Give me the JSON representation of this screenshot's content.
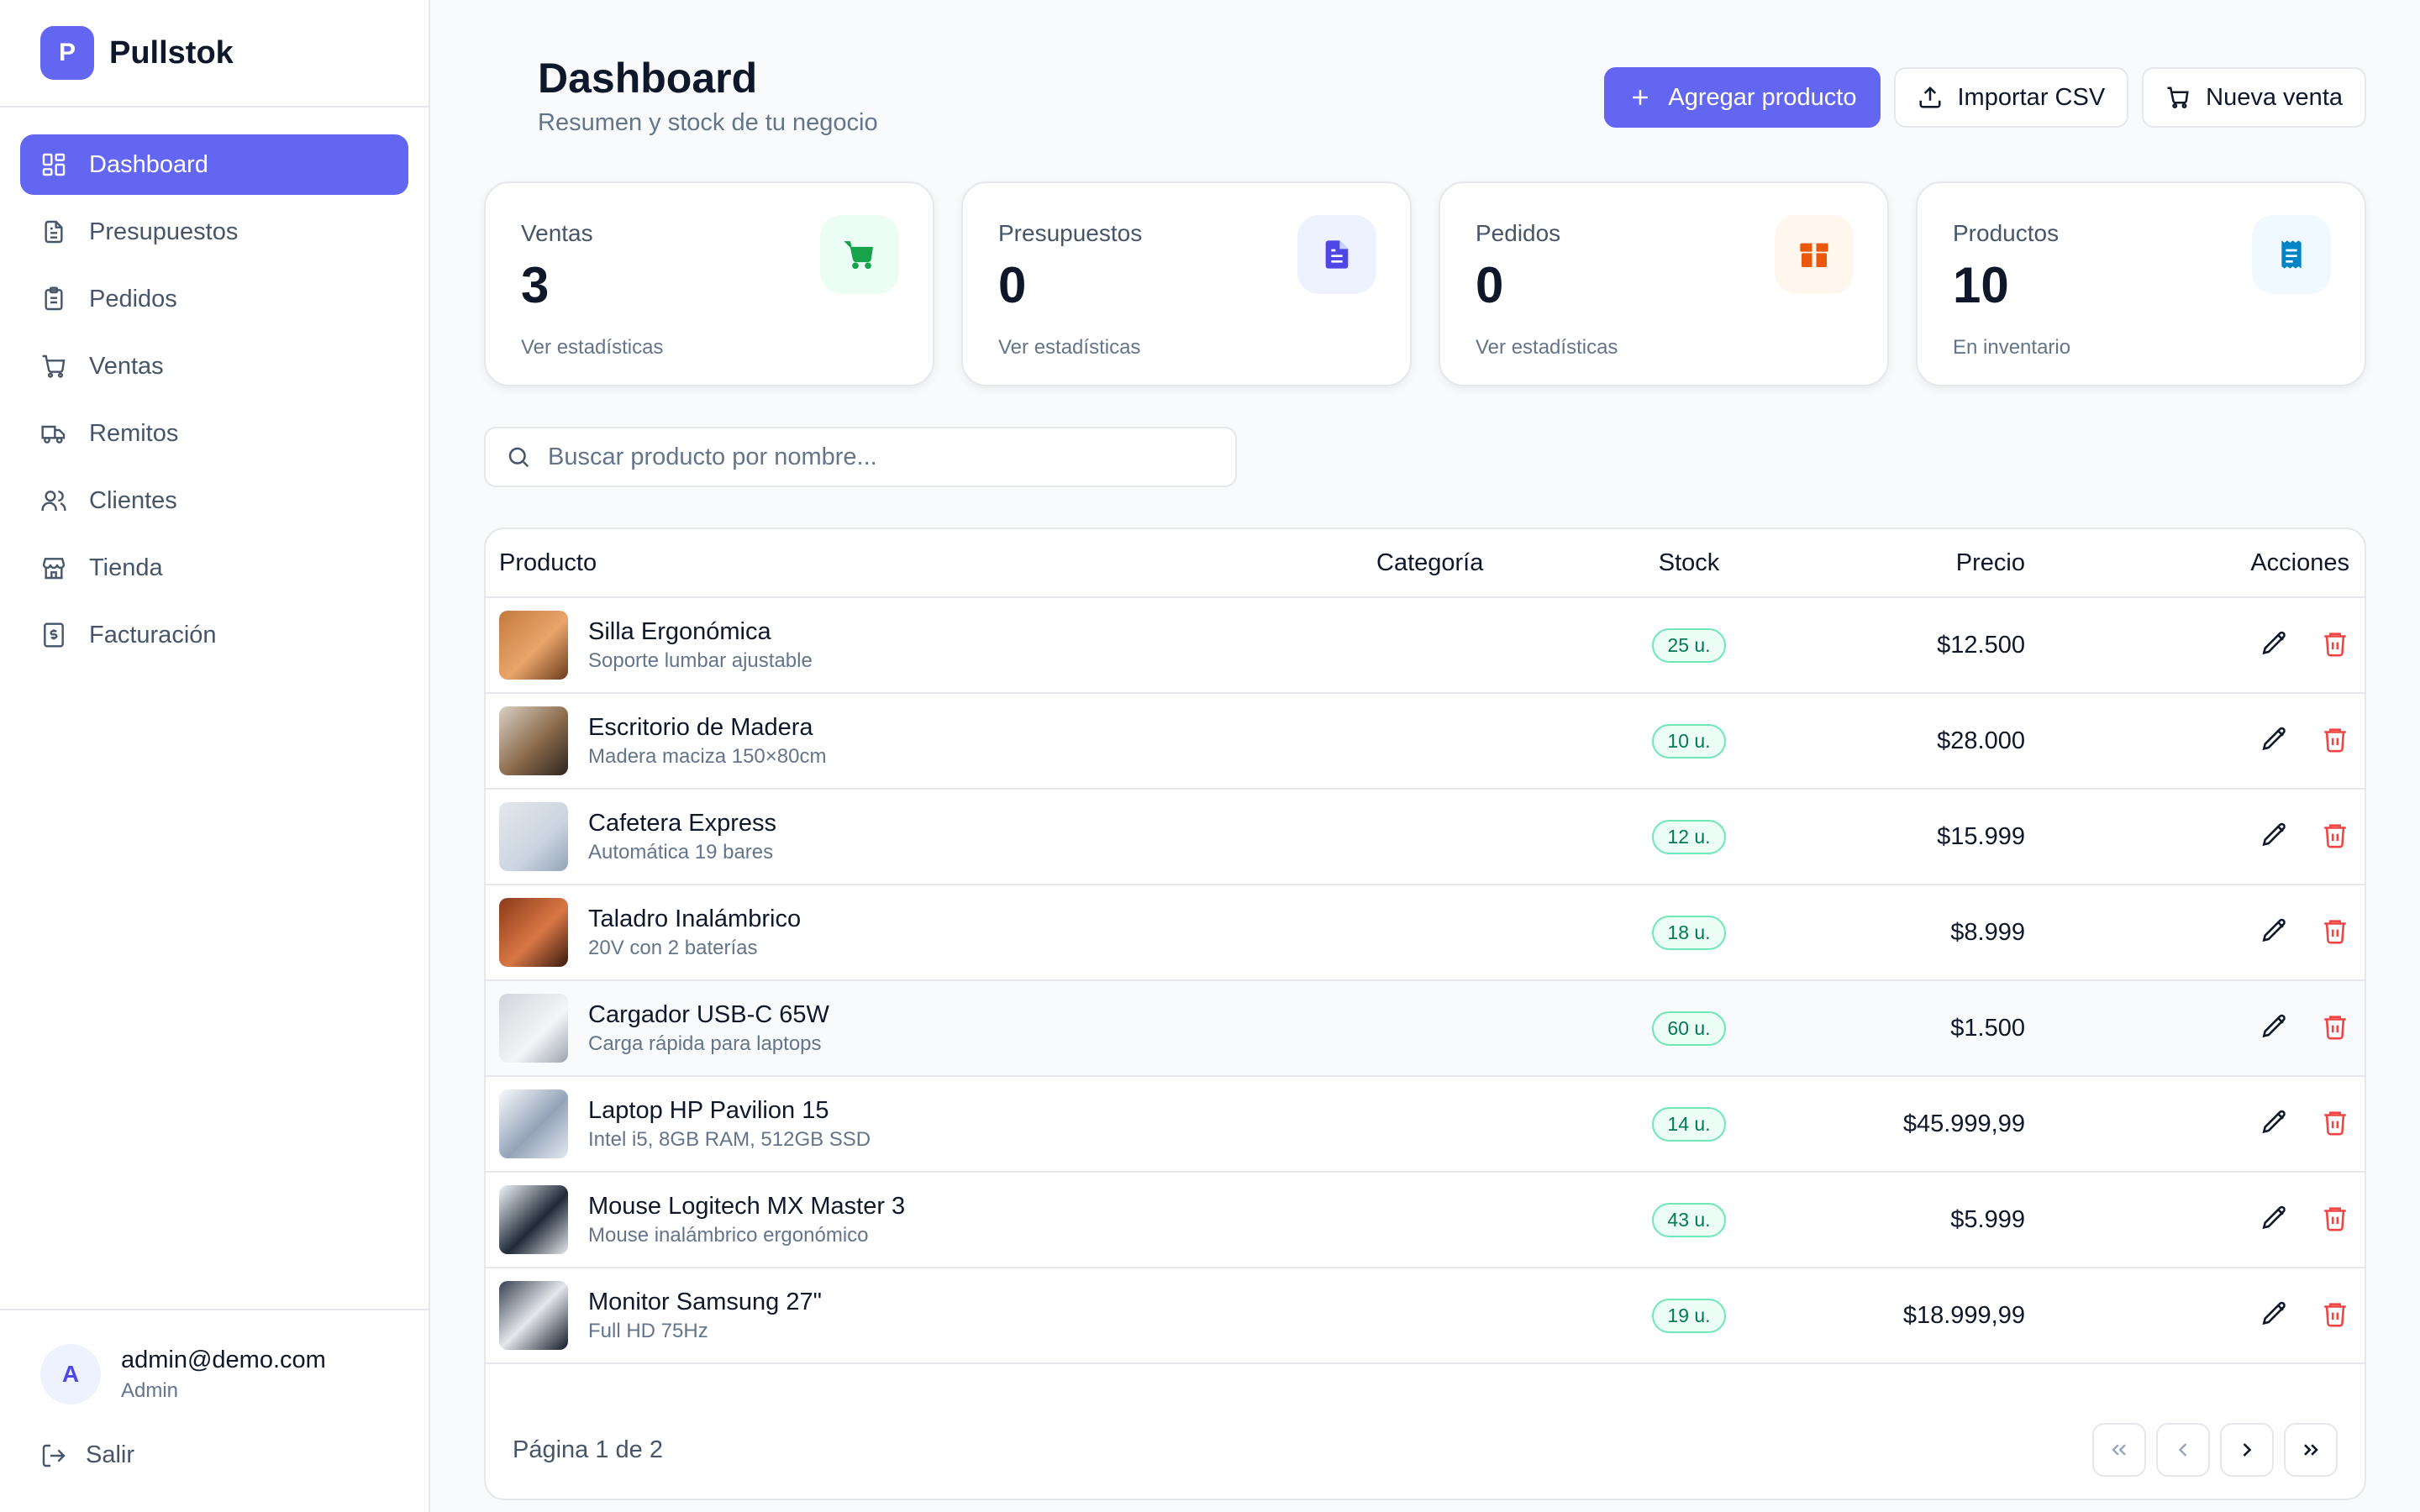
{
  "brand": {
    "logo_letter": "P",
    "name": "Pullstok"
  },
  "sidebar": {
    "items": [
      {
        "label": "Dashboard",
        "icon": "dashboard-icon",
        "active": true
      },
      {
        "label": "Presupuestos",
        "icon": "file-icon"
      },
      {
        "label": "Pedidos",
        "icon": "clipboard-icon"
      },
      {
        "label": "Ventas",
        "icon": "cart-icon"
      },
      {
        "label": "Remitos",
        "icon": "truck-icon"
      },
      {
        "label": "Clientes",
        "icon": "users-icon"
      },
      {
        "label": "Tienda",
        "icon": "store-icon"
      },
      {
        "label": "Facturación",
        "icon": "invoice-icon"
      }
    ],
    "user": {
      "avatar_letter": "A",
      "email": "admin@demo.com",
      "role": "Admin"
    },
    "logout_label": "Salir"
  },
  "header": {
    "title": "Dashboard",
    "subtitle": "Resumen y stock de tu negocio",
    "add_product_label": "Agregar producto",
    "import_csv_label": "Importar CSV",
    "new_sale_label": "Nueva venta"
  },
  "stats": [
    {
      "label": "Ventas",
      "value": "3",
      "sub": "Ver estadísticas",
      "icon": "cart-icon",
      "color": "#16a34a",
      "bg": "#ecfdf5"
    },
    {
      "label": "Presupuestos",
      "value": "0",
      "sub": "Ver estadísticas",
      "icon": "document-icon",
      "color": "#4f46e5",
      "bg": "#eef2ff"
    },
    {
      "label": "Pedidos",
      "value": "0",
      "sub": "Ver estadísticas",
      "icon": "box-icon",
      "color": "#ea580c",
      "bg": "#fff7ed"
    },
    {
      "label": "Productos",
      "value": "10",
      "sub": "En inventario",
      "icon": "receipt-icon",
      "color": "#0284c7",
      "bg": "#f0f9ff"
    }
  ],
  "search": {
    "placeholder": "Buscar producto por nombre..."
  },
  "table": {
    "columns": {
      "product": "Producto",
      "category": "Categoría",
      "stock": "Stock",
      "price": "Precio",
      "actions": "Acciones"
    },
    "rows": [
      {
        "name": "Silla Ergonómica",
        "desc": "Soporte lumbar ajustable",
        "category": "",
        "stock": "25 u.",
        "price": "$12.500"
      },
      {
        "name": "Escritorio de Madera",
        "desc": "Madera maciza 150×80cm",
        "category": "",
        "stock": "10 u.",
        "price": "$28.000"
      },
      {
        "name": "Cafetera Express",
        "desc": "Automática 19 bares",
        "category": "",
        "stock": "12 u.",
        "price": "$15.999"
      },
      {
        "name": "Taladro Inalámbrico",
        "desc": "20V con 2 baterías",
        "category": "",
        "stock": "18 u.",
        "price": "$8.999"
      },
      {
        "name": "Cargador USB-C 65W",
        "desc": "Carga rápida para laptops",
        "category": "",
        "stock": "60 u.",
        "price": "$1.500"
      },
      {
        "name": "Laptop HP Pavilion 15",
        "desc": "Intel i5, 8GB RAM, 512GB SSD",
        "category": "",
        "stock": "14 u.",
        "price": "$45.999,99"
      },
      {
        "name": "Mouse Logitech MX Master 3",
        "desc": "Mouse inalámbrico ergonómico",
        "category": "",
        "stock": "43 u.",
        "price": "$5.999"
      },
      {
        "name": "Monitor Samsung 27\"",
        "desc": "Full HD 75Hz",
        "category": "",
        "stock": "19 u.",
        "price": "$18.999,99"
      }
    ],
    "page_info": "Página 1 de 2"
  },
  "colors": {
    "accent": "#6366f1",
    "danger": "#ef4444",
    "success": "#047857"
  }
}
